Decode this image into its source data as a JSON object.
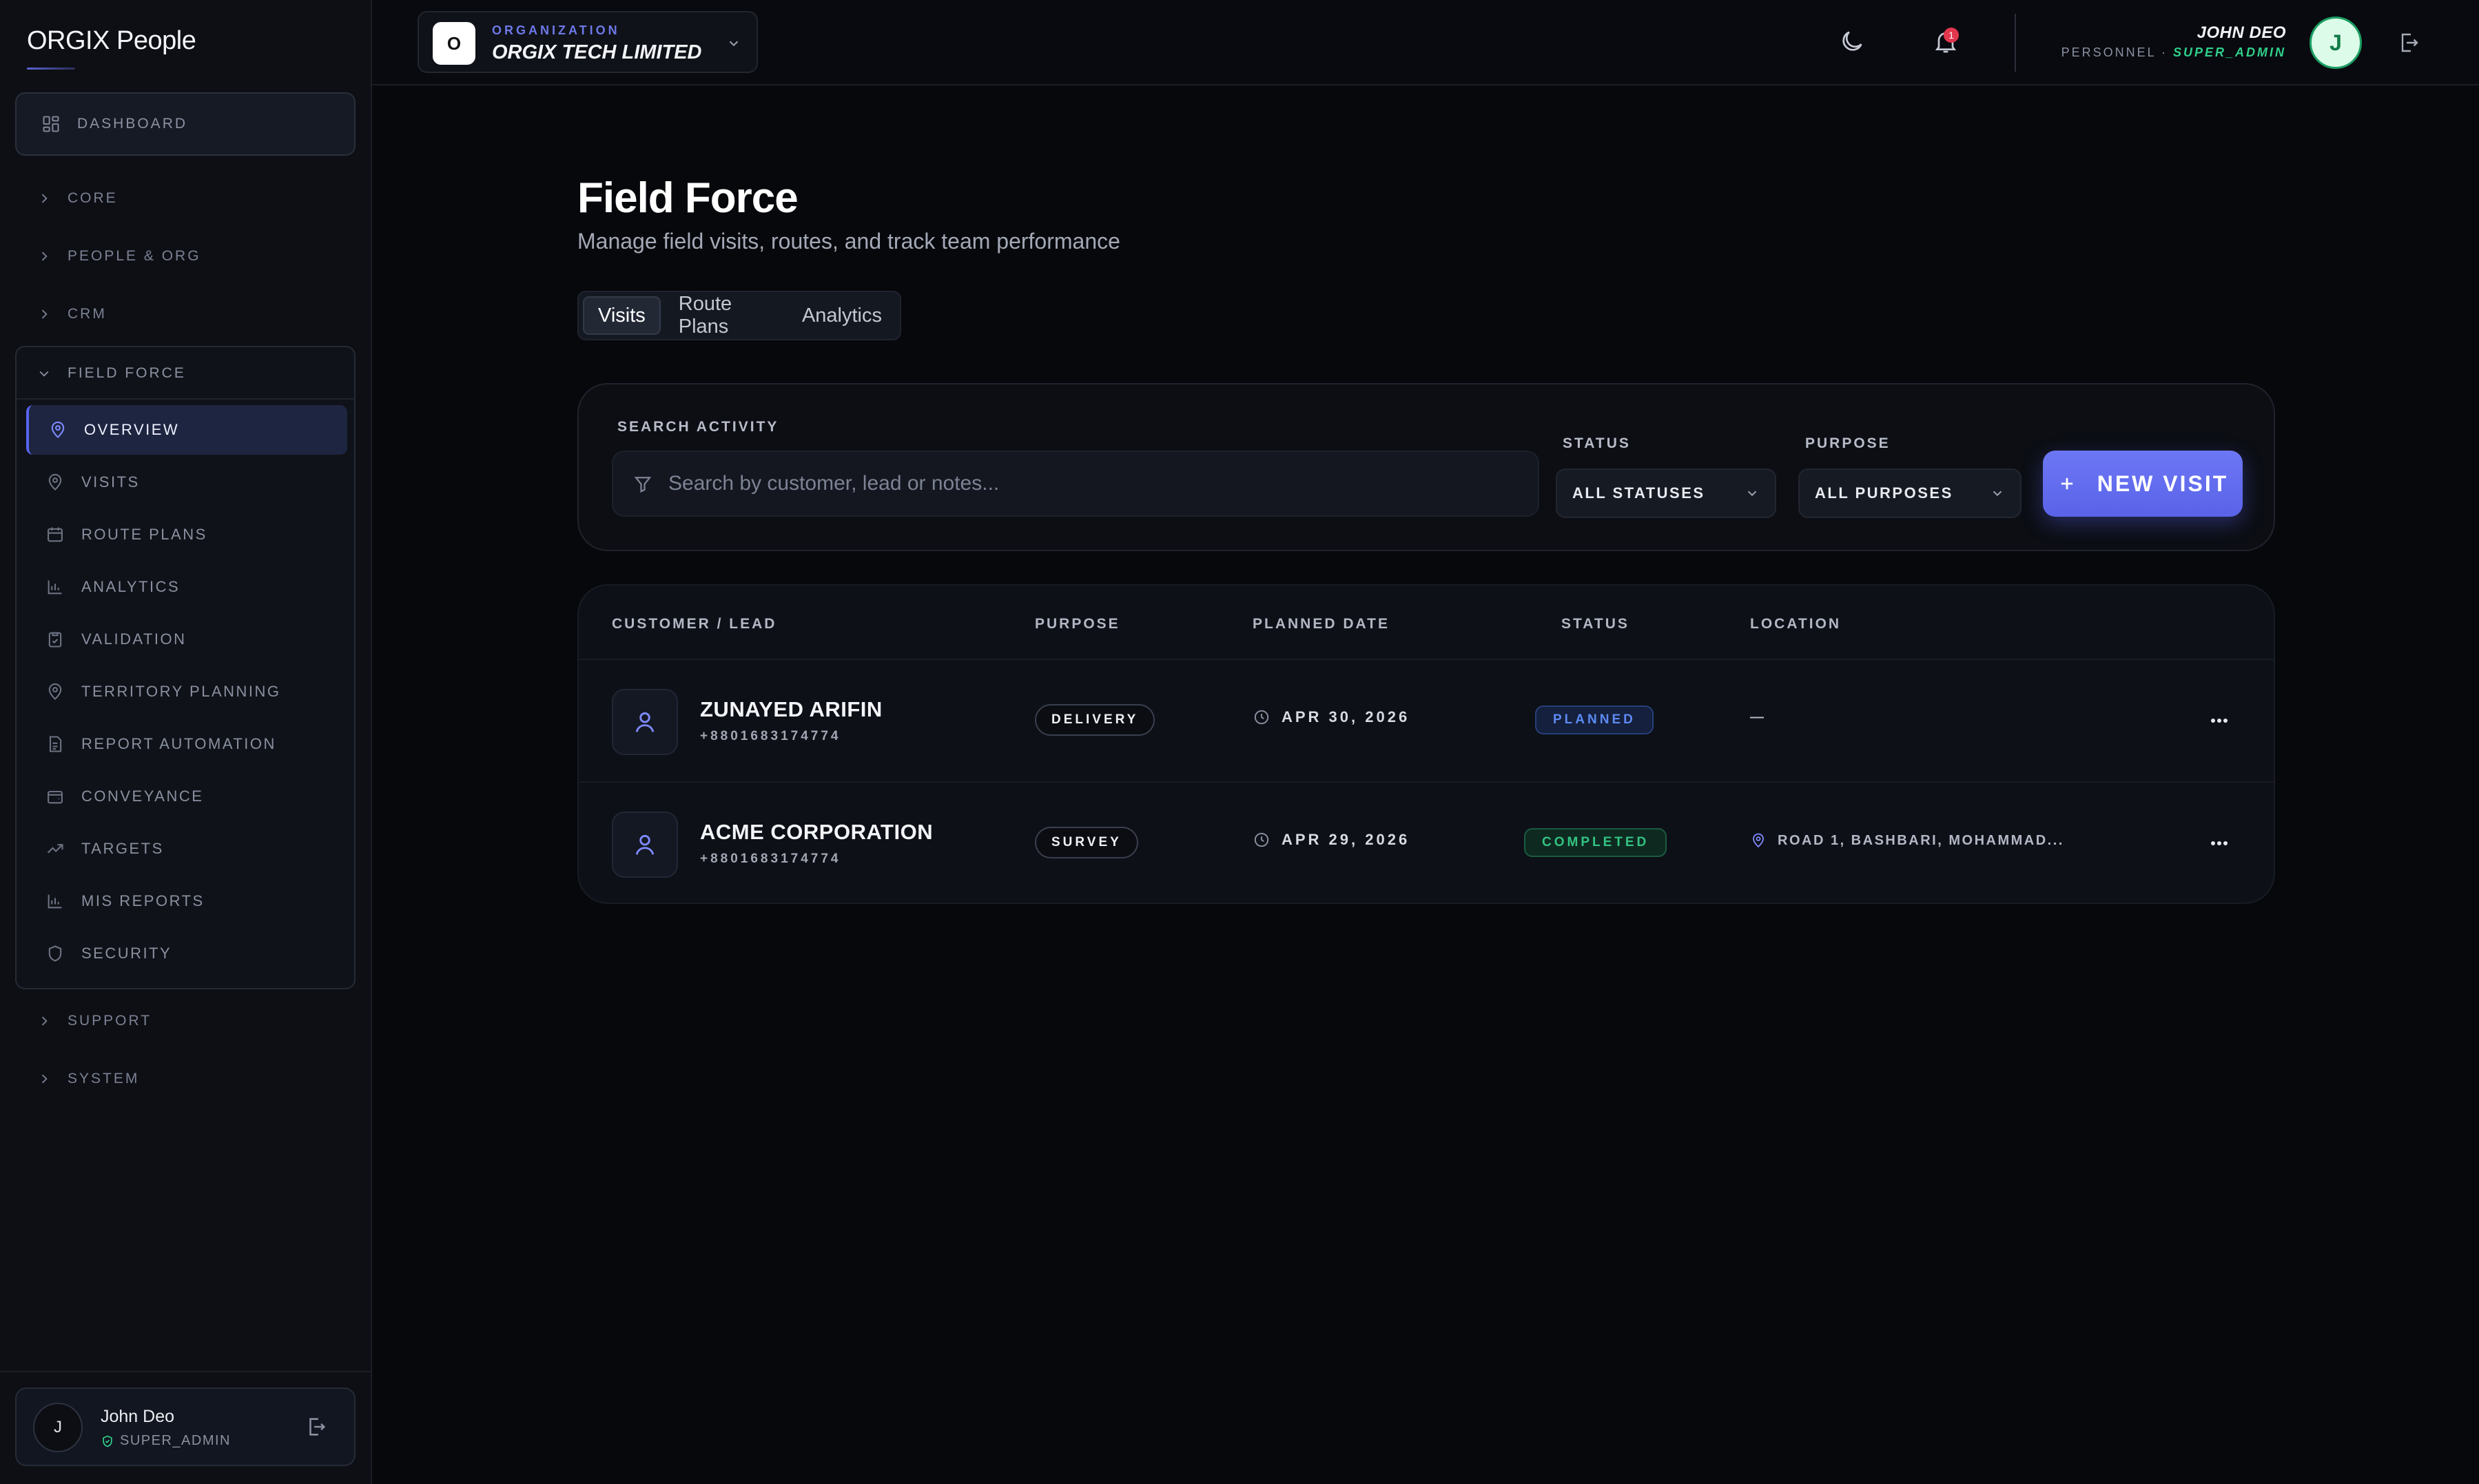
{
  "sidebar": {
    "brand": "ORGIX People",
    "dashboard": "DASHBOARD",
    "groups": {
      "core": "CORE",
      "people_org": "PEOPLE & ORG",
      "crm": "CRM",
      "field_force": "FIELD FORCE",
      "support": "SUPPORT",
      "system": "SYSTEM"
    },
    "field_force_items": [
      {
        "label": "OVERVIEW",
        "icon": "map-pin-icon",
        "active": true
      },
      {
        "label": "VISITS",
        "icon": "map-pin-icon"
      },
      {
        "label": "ROUTE PLANS",
        "icon": "calendar-icon"
      },
      {
        "label": "ANALYTICS",
        "icon": "bar-chart-icon"
      },
      {
        "label": "VALIDATION",
        "icon": "clipboard-check-icon"
      },
      {
        "label": "TERRITORY PLANNING",
        "icon": "map-pin-icon"
      },
      {
        "label": "REPORT AUTOMATION",
        "icon": "file-text-icon"
      },
      {
        "label": "CONVEYANCE",
        "icon": "wallet-icon"
      },
      {
        "label": "TARGETS",
        "icon": "trending-up-icon"
      },
      {
        "label": "MIS REPORTS",
        "icon": "bar-chart-icon"
      },
      {
        "label": "SECURITY",
        "icon": "shield-icon"
      }
    ],
    "user": {
      "initial": "J",
      "name": "John Deo",
      "role": "SUPER_ADMIN"
    }
  },
  "topbar": {
    "org_logo_letter": "O",
    "org_eyebrow": "ORGANIZATION",
    "org_name": "ORGIX TECH LIMITED",
    "notification_count": "1",
    "user_name": "JOHN DEO",
    "user_dept": "PERSONNEL",
    "user_separator": "·",
    "user_role": "SUPER_ADMIN",
    "avatar_initial": "J"
  },
  "page": {
    "title": "Field Force",
    "subtitle": "Manage field visits, routes, and track team performance",
    "tabs": [
      "Visits",
      "Route Plans",
      "Analytics"
    ],
    "active_tab": "Visits"
  },
  "filters": {
    "search_label": "SEARCH ACTIVITY",
    "search_placeholder": "Search by customer, lead or notes...",
    "status_label": "STATUS",
    "status_value": "ALL STATUSES",
    "purpose_label": "PURPOSE",
    "purpose_value": "ALL PURPOSES",
    "new_visit": "NEW VISIT"
  },
  "table": {
    "headers": [
      "CUSTOMER / LEAD",
      "PURPOSE",
      "PLANNED DATE",
      "STATUS",
      "LOCATION"
    ],
    "rows": [
      {
        "name": "ZUNAYED ARIFIN",
        "phone": "+8801683174774",
        "purpose": "DELIVERY",
        "date": "APR 30, 2026",
        "status": "PLANNED",
        "location": "—"
      },
      {
        "name": "ACME CORPORATION",
        "phone": "+8801683174774",
        "purpose": "SURVEY",
        "date": "APR 29, 2026",
        "status": "COMPLETED",
        "location": "ROAD 1, BASHBARI, MOHAMMAD..."
      }
    ]
  },
  "colors": {
    "accent": "#5865f2",
    "planned": "#5d8af4",
    "completed": "#33c383",
    "role": "#2fd08b",
    "badge": "#e2364d"
  }
}
